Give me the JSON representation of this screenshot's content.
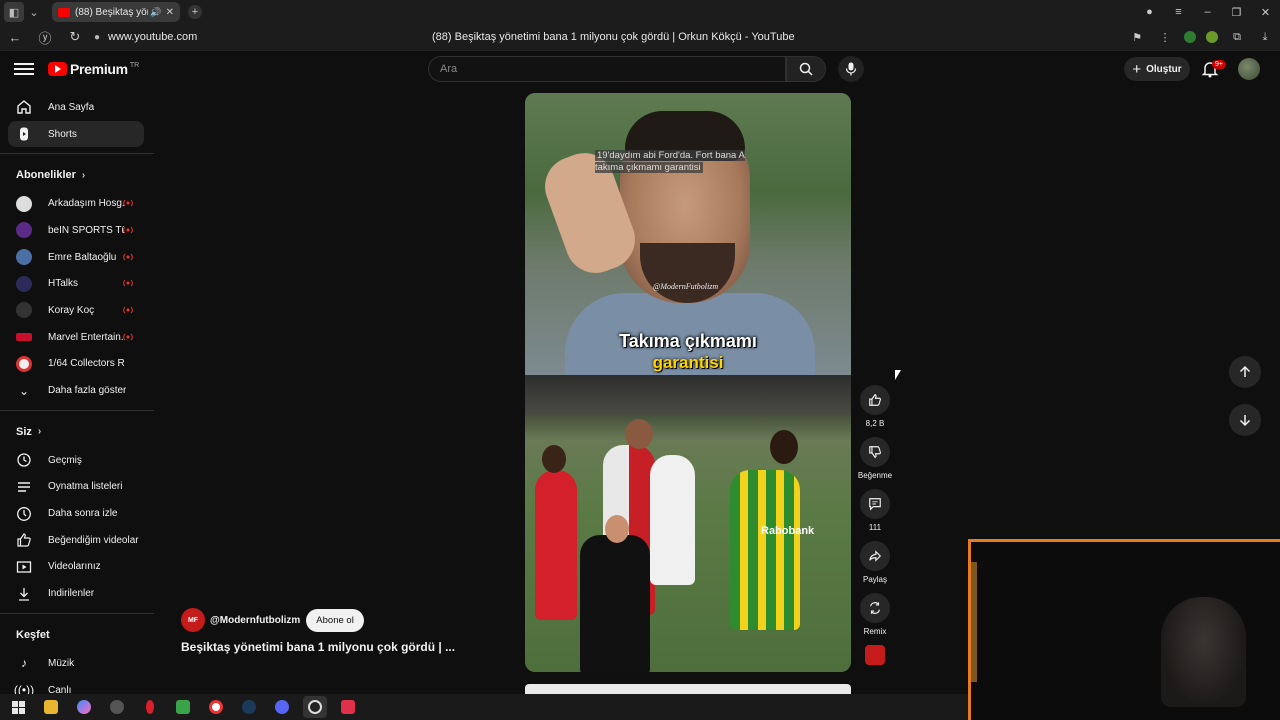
{
  "browser": {
    "tab_title": "(88) Beşiktaş yönetimi bana 1 milyonu çok gördü | Orkun Kökçü - YouTube",
    "tab_short": "(88) Beşiktaş yöneti",
    "url": "www.youtube.com",
    "page_title": "(88) Beşiktaş yönetimi bana 1 milyonu çok gördü | Orkun Kökçü - YouTube"
  },
  "header": {
    "logo": "Premium",
    "logo_country": "TR",
    "search_placeholder": "Ara",
    "create_label": "Oluştur",
    "notifications_badge": "9+"
  },
  "sidebar": {
    "main": [
      {
        "label": "Ana Sayfa",
        "icon": "home-icon"
      },
      {
        "label": "Shorts",
        "icon": "shorts-icon"
      }
    ],
    "subscriptions_title": "Abonelikler",
    "subscriptions": [
      {
        "label": "Arkadaşım Hosg...",
        "color": "#dddddd"
      },
      {
        "label": "beIN SPORTS Tü...",
        "color": "#5b2a86"
      },
      {
        "label": "Emre Baltaoğlu",
        "color": "#4a6fa5"
      },
      {
        "label": "HTalks",
        "color": "#2b2b5a"
      },
      {
        "label": "Koray Koç",
        "color": "#333333"
      },
      {
        "label": "Marvel Entertain...",
        "color": "#c8102e"
      },
      {
        "label": "1/64 Collectors Ro...",
        "color": "#e8e8e8"
      }
    ],
    "show_more": "Daha fazla göster",
    "you_title": "Siz",
    "you": [
      {
        "label": "Geçmiş",
        "icon": "history-icon"
      },
      {
        "label": "Oynatma listeleri",
        "icon": "playlist-icon"
      },
      {
        "label": "Daha sonra izle",
        "icon": "watch-later-icon"
      },
      {
        "label": "Beğendiğim videolar",
        "icon": "liked-icon"
      },
      {
        "label": "Videolarınız",
        "icon": "your-videos-icon"
      },
      {
        "label": "İndirilenler",
        "icon": "download-icon"
      }
    ],
    "explore_title": "Keşfet",
    "explore": [
      {
        "label": "Müzik",
        "icon": "music-icon"
      },
      {
        "label": "Canlı",
        "icon": "live-icon"
      }
    ]
  },
  "video": {
    "caption": "19'daydım abi Ford'da. Fort bana A takıma çıkmamı garantisi",
    "watermark": "@ModernFutbolizm",
    "subtitle_line1": "Takıma çıkmamı",
    "subtitle_line2": "garantisi",
    "shirt_sponsor": "Rabobank",
    "channel": "@Modernfutbolizm",
    "subscribe_label": "Abone ol",
    "title": "Beşiktaş yönetimi bana 1 milyonu çok gördü | ..."
  },
  "actions": {
    "likes": "8,2 B",
    "dislike_label": "Beğenme",
    "comments": "111",
    "share_label": "Paylaş",
    "remix_label": "Remix"
  }
}
